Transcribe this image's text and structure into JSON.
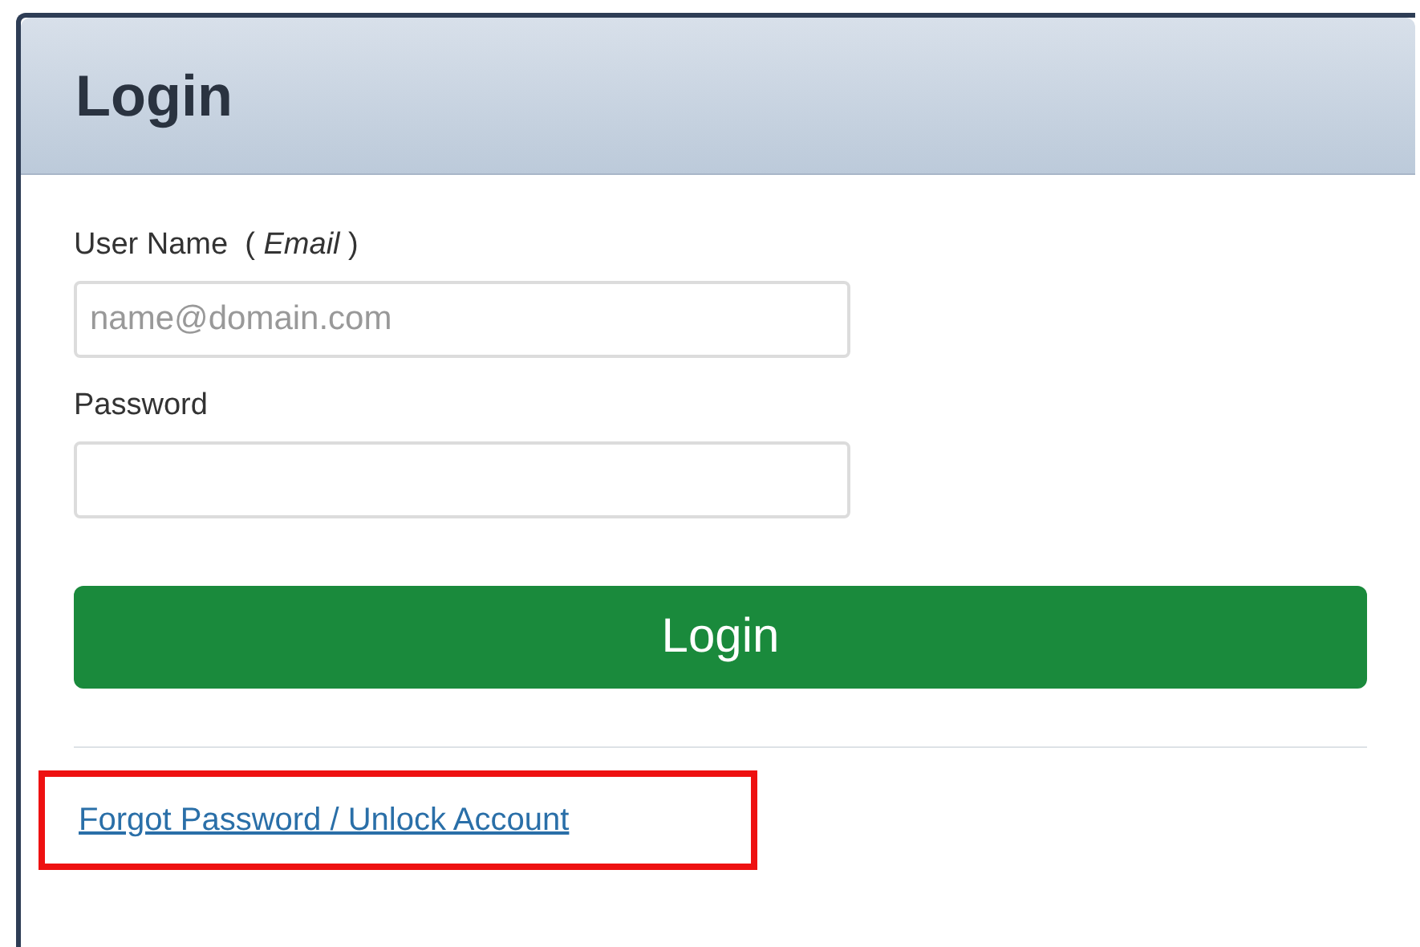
{
  "dialog": {
    "title": "Login"
  },
  "fields": [
    {
      "label": "User Name  ( *Email* )",
      "placeholder": "name@domain.com"
    },
    {
      "label": "Password"
    }
  ],
  "login_button": {
    "label": "Login"
  },
  "forgot_link": {
    "label": "Forgot Password / Unlock Account",
    "highlighted": true
  }
}
